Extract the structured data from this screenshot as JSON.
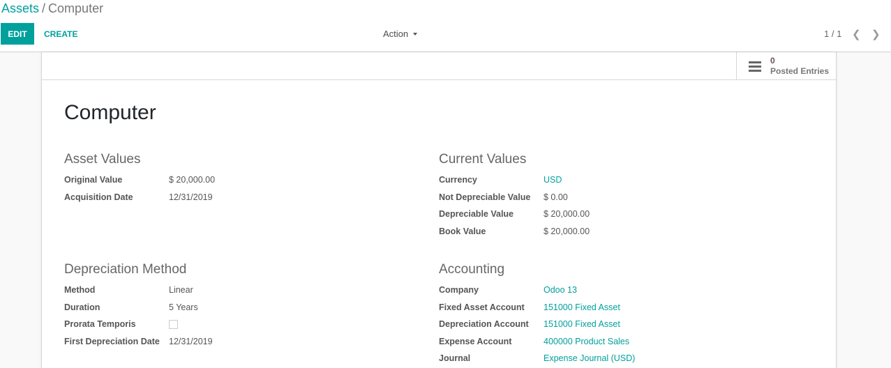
{
  "breadcrumb": {
    "parent": "Assets",
    "separator": "/",
    "current": "Computer"
  },
  "toolbar": {
    "edit_label": "EDIT",
    "create_label": "CREATE",
    "action_label": "Action"
  },
  "pager": {
    "value": "1 / 1",
    "prev_icon": "chevron-left",
    "next_icon": "chevron-right"
  },
  "smart_button": {
    "icon": "list-icon",
    "value": "0",
    "label": "Posted Entries"
  },
  "record": {
    "title": "Computer"
  },
  "asset_values": {
    "heading": "Asset Values",
    "fields": [
      {
        "label": "Original Value",
        "value": "$ 20,000.00"
      },
      {
        "label": "Acquisition Date",
        "value": "12/31/2019"
      }
    ]
  },
  "current_values": {
    "heading": "Current Values",
    "fields": [
      {
        "label": "Currency",
        "value": "USD"
      },
      {
        "label": "Not Depreciable Value",
        "value": "$ 0.00"
      },
      {
        "label": "Depreciable Value",
        "value": "$ 20,000.00"
      },
      {
        "label": "Book Value",
        "value": "$ 20,000.00"
      }
    ]
  },
  "depreciation_method": {
    "heading": "Depreciation Method",
    "fields": [
      {
        "label": "Method",
        "value": "Linear"
      },
      {
        "label": "Duration",
        "value": "5 Years"
      },
      {
        "label": "Prorata Temporis",
        "checked": false
      },
      {
        "label": "First Depreciation Date",
        "value": "12/31/2019"
      }
    ]
  },
  "accounting": {
    "heading": "Accounting",
    "fields": [
      {
        "label": "Company",
        "value": "Odoo 13"
      },
      {
        "label": "Fixed Asset Account",
        "value": "151000 Fixed Asset"
      },
      {
        "label": "Depreciation Account",
        "value": "151000 Fixed Asset"
      },
      {
        "label": "Expense Account",
        "value": "400000 Product Sales"
      },
      {
        "label": "Journal",
        "value": "Expense Journal (USD)"
      }
    ]
  },
  "colors": {
    "accent": "#00A09D"
  }
}
